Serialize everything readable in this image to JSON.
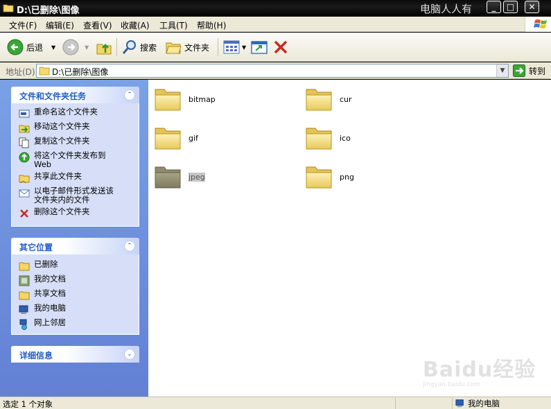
{
  "window": {
    "title": "D:\\已删除\\图像",
    "watermark_text": "电脑人人有",
    "controls": {
      "minimize": "_",
      "maximize": "□",
      "close": "✕"
    }
  },
  "menu": {
    "items": [
      "文件(F)",
      "编辑(E)",
      "查看(V)",
      "收藏(A)",
      "工具(T)",
      "帮助(H)"
    ]
  },
  "toolbar": {
    "back_label": "后退",
    "search_label": "搜索",
    "folders_label": "文件夹"
  },
  "address": {
    "label": "地址(D)",
    "value": "D:\\已删除\\图像",
    "go_label": "转到"
  },
  "tasks_panel": {
    "title": "文件和文件夹任务",
    "items": [
      {
        "label": "重命名这个文件夹",
        "icon": "rename-icon"
      },
      {
        "label": "移动这个文件夹",
        "icon": "move-icon"
      },
      {
        "label": "复制这个文件夹",
        "icon": "copy-icon"
      },
      {
        "label": "将这个文件夹发布到 Web",
        "icon": "publish-web-icon"
      },
      {
        "label": "共享此文件夹",
        "icon": "share-icon"
      },
      {
        "label": "以电子邮件形式发送该文件夹内的文件",
        "icon": "email-icon"
      },
      {
        "label": "删除这个文件夹",
        "icon": "delete-icon"
      }
    ]
  },
  "places_panel": {
    "title": "其它位置",
    "items": [
      {
        "label": "已删除",
        "icon": "folder-icon"
      },
      {
        "label": "我的文档",
        "icon": "my-documents-icon"
      },
      {
        "label": "共享文档",
        "icon": "shared-documents-icon"
      },
      {
        "label": "我的电脑",
        "icon": "my-computer-icon"
      },
      {
        "label": "网上邻居",
        "icon": "network-places-icon"
      }
    ]
  },
  "details_panel": {
    "title": "详细信息"
  },
  "folders": [
    {
      "name": "bitmap",
      "selected": false
    },
    {
      "name": "cur",
      "selected": false
    },
    {
      "name": "gif",
      "selected": false
    },
    {
      "name": "ico",
      "selected": false
    },
    {
      "name": "jpeg",
      "selected": true
    },
    {
      "name": "png",
      "selected": false
    }
  ],
  "status": {
    "selection": "选定 1 个对象",
    "location": "我的电脑"
  },
  "baidu_watermark": {
    "line1": "Baidu经验",
    "line2": "jingyan.baidu.com"
  },
  "colors": {
    "folder_yellow": "#f7e08a",
    "pane_blue": "#6f8fdd",
    "panel_title": "#215dc6"
  }
}
